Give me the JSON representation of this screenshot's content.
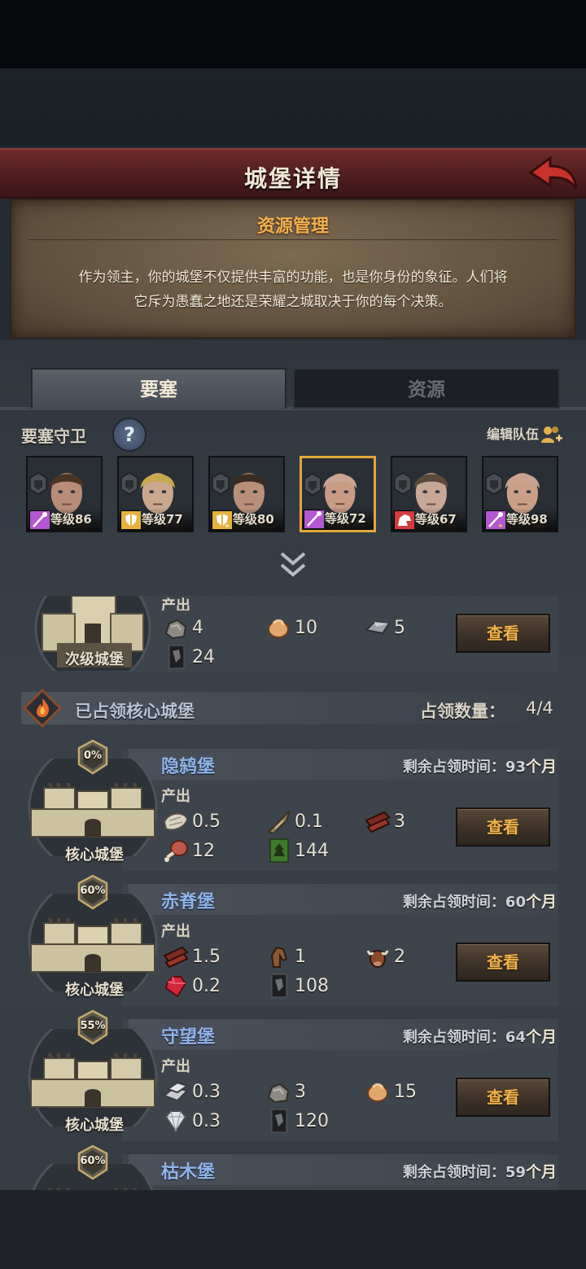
{
  "header": {
    "title": "城堡详情"
  },
  "intro": {
    "title": "资源管理",
    "line1": "作为领主，你的城堡不仅提供丰富的功能，也是你身份的象征。人们将",
    "line2": "它斥为愚蠢之地还是荣耀之城取决于你的每个决策。"
  },
  "tabs": {
    "fortress": "要塞",
    "resource": "资源"
  },
  "guards": {
    "title": "要塞守卫",
    "help": "?",
    "edit_team": "编辑队伍",
    "heroes": [
      {
        "level": "等级86",
        "role": "staff",
        "role_color": "#b457d2",
        "skin": "#b88d78",
        "hair": "#4a3424",
        "selected": false
      },
      {
        "level": "等级77",
        "role": "shield",
        "role_color": "#e6b23c",
        "skin": "#c9a88e",
        "hair": "#c8a84c",
        "selected": false
      },
      {
        "level": "等级80",
        "role": "shield-star",
        "role_color": "#e6b23c",
        "skin": "#b8907a",
        "hair": "#3b2c22",
        "selected": false
      },
      {
        "level": "等级72",
        "role": "staff",
        "role_color": "#b457d2",
        "skin": "#c79b84",
        "hair": "#caa592",
        "selected": true
      },
      {
        "level": "等级67",
        "role": "beast",
        "role_color": "#d23c3c",
        "skin": "#c7a795",
        "hair": "#5a4a3a",
        "selected": false
      },
      {
        "level": "等级98",
        "role": "staff-star",
        "role_color": "#b457d2",
        "skin": "#c99f88",
        "hair": "#c9a38f",
        "selected": false
      }
    ]
  },
  "secondary_castle": {
    "label": "次级城堡",
    "produce_label": "产出",
    "resources": [
      {
        "icon": "stone-icon",
        "value": "4"
      },
      {
        "icon": "meat-icon",
        "value": "10"
      },
      {
        "icon": "iron-icon",
        "value": "5"
      },
      {
        "icon": "banner-icon",
        "value": "24"
      }
    ],
    "view_label": "查看"
  },
  "core_section": {
    "title": "已占领核心城堡",
    "count_label": "占领数量：",
    "count": "4/4"
  },
  "core_castles": [
    {
      "name": "隐鸫堡",
      "percent": "0%",
      "label": "核心城堡",
      "remain_label": "剩余占领时间：",
      "remain_value": "93",
      "remain_unit": "个月",
      "produce_label": "产出",
      "view_label": "查看",
      "resources": [
        {
          "icon": "fur-icon",
          "value": "0.5"
        },
        {
          "icon": "horn-icon",
          "value": "0.1"
        },
        {
          "icon": "wood-icon",
          "value": "3"
        },
        {
          "icon": "ham-icon",
          "value": "12"
        },
        {
          "icon": "green-banner-icon",
          "value": "144"
        }
      ]
    },
    {
      "name": "赤脊堡",
      "percent": "60%",
      "label": "核心城堡",
      "remain_label": "剩余占领时间：",
      "remain_value": "60",
      "remain_unit": "个月",
      "produce_label": "产出",
      "view_label": "查看",
      "resources": [
        {
          "icon": "wood-icon",
          "value": "1.5"
        },
        {
          "icon": "horse-icon",
          "value": "1"
        },
        {
          "icon": "ox-icon",
          "value": "2"
        },
        {
          "icon": "ruby-icon",
          "value": "0.2"
        },
        {
          "icon": "banner-icon",
          "value": "108"
        }
      ]
    },
    {
      "name": "守望堡",
      "percent": "55%",
      "label": "核心城堡",
      "remain_label": "剩余占领时间：",
      "remain_value": "64",
      "remain_unit": "个月",
      "produce_label": "产出",
      "view_label": "查看",
      "resources": [
        {
          "icon": "silver-icon",
          "value": "0.3"
        },
        {
          "icon": "stone-icon",
          "value": "3"
        },
        {
          "icon": "meat-icon",
          "value": "15"
        },
        {
          "icon": "diamond-icon",
          "value": "0.3"
        },
        {
          "icon": "banner-icon",
          "value": "120"
        }
      ]
    },
    {
      "name": "枯木堡",
      "percent": "60%",
      "label": "",
      "remain_label": "剩余占领时间：",
      "remain_value": "59",
      "remain_unit": "个月"
    }
  ]
}
